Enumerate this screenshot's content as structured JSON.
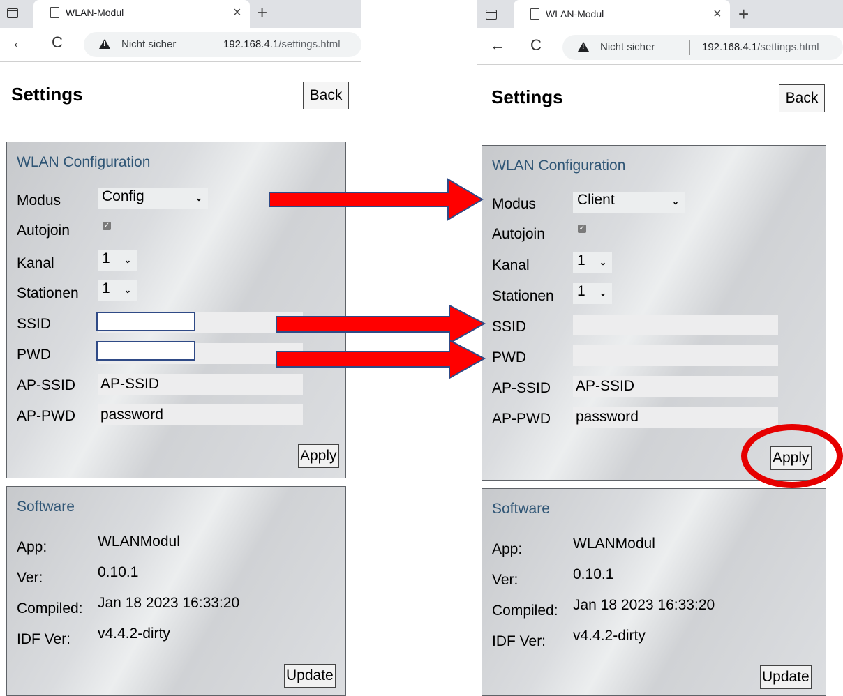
{
  "browser": {
    "tab_title": "WLAN-Modul",
    "tab_close": "×",
    "new_tab": "+",
    "back_arrow": "←",
    "reload": "C",
    "security_label": "Nicht sicher",
    "url_host": "192.168.4.1",
    "url_path": "/settings.html"
  },
  "page": {
    "title": "Settings",
    "back_label": "Back"
  },
  "wlan": {
    "heading": "WLAN Configuration",
    "modus_label": "Modus",
    "autojoin_label": "Autojoin",
    "kanal_label": "Kanal",
    "stationen_label": "Stationen",
    "ssid_label": "SSID",
    "pwd_label": "PWD",
    "apssid_label": "AP-SSID",
    "appwd_label": "AP-PWD",
    "apply_label": "Apply",
    "kanal_value": "1",
    "stationen_value": "1",
    "apssid_value": "AP-SSID",
    "appwd_value": "password",
    "autojoin_checked": true
  },
  "software": {
    "heading": "Software",
    "app_label": "App:",
    "app_value": "WLANModul",
    "ver_label": "Ver:",
    "ver_value": "0.10.1",
    "compiled_label": "Compiled:",
    "compiled_value": "Jan 18 2023 16:33:20",
    "idf_label": "IDF Ver:",
    "idf_value": "v4.4.2-dirty",
    "update_label": "Update"
  },
  "left": {
    "modus_value": "Config",
    "ssid_redacted": true,
    "pwd_redacted": true
  },
  "right": {
    "modus_value": "Client",
    "ssid_value": "",
    "pwd_value": ""
  },
  "annotations": {
    "arrow_color": "#ff0000",
    "arrow_outline": "#2f4a86",
    "circle_color": "#e60000"
  }
}
